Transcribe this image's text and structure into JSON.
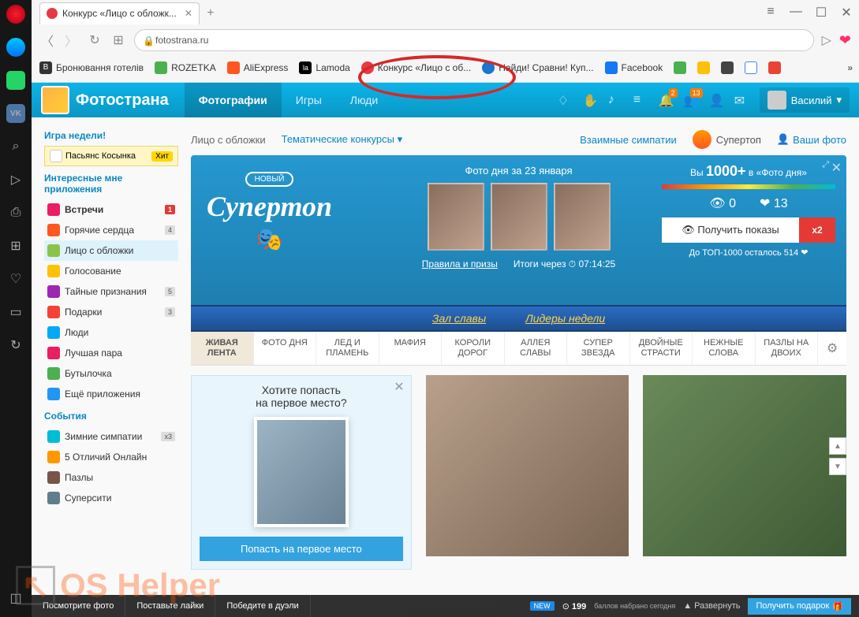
{
  "browser": {
    "tab_title": "Конкурс «Лицо с обложк...",
    "url": "fotostrana.ru",
    "bookmarks": [
      {
        "label": "Бронювання готелів",
        "color": "#333"
      },
      {
        "label": "ROZETKA",
        "color": "#4caf50"
      },
      {
        "label": "AliExpress",
        "color": "#ff5722"
      },
      {
        "label": "Lamoda",
        "color": "#000"
      },
      {
        "label": "Конкурс «Лицо с об...",
        "color": "#e63946"
      },
      {
        "label": "Найди! Сравни! Куп...",
        "color": "#1976d2"
      },
      {
        "label": "Facebook",
        "color": "#1877f2"
      }
    ]
  },
  "site": {
    "brand": "Фотострана",
    "nav": [
      "Фотографии",
      "Игры",
      "Люди"
    ],
    "user": "Василий",
    "notif1": "2",
    "notif2": "13"
  },
  "sidebar": {
    "game_week": "Игра недели!",
    "hit_game": "Пасьянс Косынка",
    "hit_label": "Хит",
    "apps_title": "Интересные мне приложения",
    "apps": [
      {
        "label": "Встречи",
        "count": "1",
        "red": true,
        "bold": true,
        "ico": "#e91e63"
      },
      {
        "label": "Горячие сердца",
        "count": "4",
        "ico": "#ff5722"
      },
      {
        "label": "Лицо с обложки",
        "active": true,
        "ico": "#8bc34a"
      },
      {
        "label": "Голосование",
        "ico": "#ffc107"
      },
      {
        "label": "Тайные признания",
        "count": "5",
        "ico": "#9c27b0"
      },
      {
        "label": "Подарки",
        "count": "3",
        "ico": "#f44336"
      },
      {
        "label": "Люди",
        "ico": "#03a9f4"
      },
      {
        "label": "Лучшая пара",
        "ico": "#e91e63"
      },
      {
        "label": "Бутылочка",
        "ico": "#4caf50"
      },
      {
        "label": "Ещё приложения",
        "ico": "#2196f3"
      }
    ],
    "events_title": "События",
    "events": [
      {
        "label": "Зимние симпатии",
        "count": "x3",
        "ico": "#00bcd4"
      },
      {
        "label": "5 Отличий Онлайн",
        "ico": "#ff9800"
      },
      {
        "label": "Пазлы",
        "ico": "#795548"
      },
      {
        "label": "Суперсити",
        "ico": "#607d8b"
      }
    ]
  },
  "subnav": {
    "a": "Лицо с обложки",
    "b": "Тематические конкурсы",
    "c": "Взаимные симпатии",
    "d": "Супертоп",
    "e": "Ваши фото"
  },
  "hero": {
    "day_title": "Фото дня за 23 января",
    "novy": "НОВЫЙ",
    "supertop": "Супертоп",
    "rules": "Правила и призы",
    "timer_label": "Итоги через",
    "timer": "07:14:25",
    "you_label": "Вы",
    "you_count": "1000+",
    "you_in": "в «Фото дня»",
    "views": "0",
    "likes": "13",
    "get_views": "Получить показы",
    "x2": "x2",
    "top1000": "До ТОП-1000 осталось 514"
  },
  "ribbon": {
    "hall": "Зал славы",
    "leaders": "Лидеры недели"
  },
  "tabs": [
    "ЖИВАЯ ЛЕНТА",
    "ФОТО ДНЯ",
    "ЛЕД И ПЛАМЕНЬ",
    "МАФИЯ",
    "КОРОЛИ ДОРОГ",
    "АЛЛЕЯ СЛАВЫ",
    "СУПЕР ЗВЕЗДА",
    "ДВОЙНЫЕ СТРАСТИ",
    "НЕЖНЫЕ СЛОВА",
    "ПАЗЛЫ НА ДВОИХ"
  ],
  "promo": {
    "title1": "Хотите попасть",
    "title2": "на первое место?",
    "btn": "Попасть на первое место"
  },
  "footer": {
    "items": [
      "Посмотрите фото",
      "Поставьте лайки",
      "Победите в дуэли"
    ],
    "new": "NEW",
    "points": "199",
    "points_label": "баллов набрано сегодня",
    "expand": "Развернуть",
    "gift": "Получить подарок"
  },
  "watermark": "OS Helper"
}
